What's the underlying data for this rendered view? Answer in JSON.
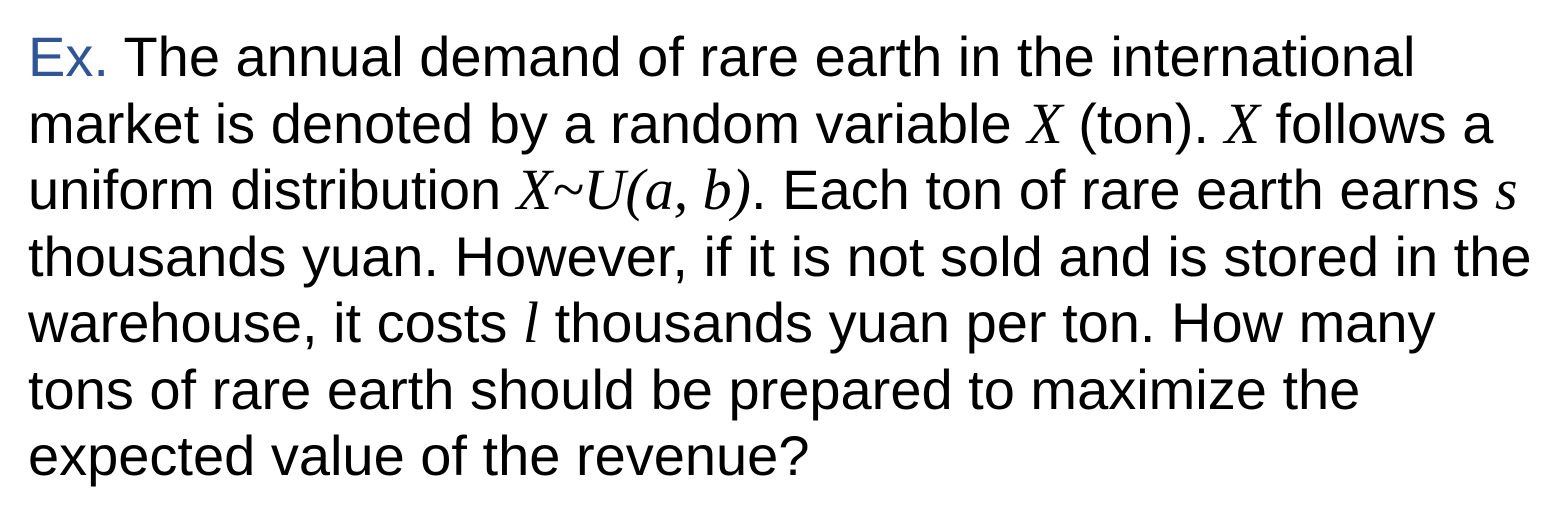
{
  "problem": {
    "label": "Ex.",
    "l1": " The annual demand of rare earth in the international",
    "l2a": "market is denoted by a random variable ",
    "var_x": "X",
    "l2b": " (ton). ",
    "l2c": " follows a",
    "l3a": "uniform distribution ",
    "dist": "X~U(a, b)",
    "l3b": ". Each ton of rare earth earns ",
    "var_s": "s",
    "l4": "thousands yuan. However, if it is not sold and is stored in the",
    "l5a": "warehouse, it costs ",
    "var_l": "l",
    "l5b": " thousands yuan per ton. How many",
    "l6": "tons of rare earth should be prepared to maximize the",
    "l7": "expected value of the revenue?"
  }
}
